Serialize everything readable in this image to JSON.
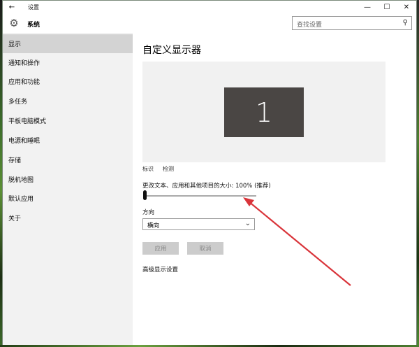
{
  "window": {
    "title": "设置",
    "back_icon": "back-arrow-icon",
    "controls": {
      "minimize": "—",
      "maximize": "☐",
      "close": "✕"
    }
  },
  "header": {
    "app_title": "系统",
    "search_placeholder": "查找设置"
  },
  "sidebar": {
    "items": [
      {
        "label": "显示",
        "active": true
      },
      {
        "label": "通知和操作"
      },
      {
        "label": "应用和功能"
      },
      {
        "label": "多任务"
      },
      {
        "label": "平板电脑模式"
      },
      {
        "label": "电源和睡眠"
      },
      {
        "label": "存储"
      },
      {
        "label": "脱机地图"
      },
      {
        "label": "默认应用"
      },
      {
        "label": "关于"
      }
    ]
  },
  "main": {
    "title": "自定义显示器",
    "monitor_number": "1",
    "identify_link": "标识",
    "detect_link": "检测",
    "scale_label": "更改文本、应用和其他项目的大小: 100% (推荐)",
    "scale_value": 100,
    "orientation_label": "方向",
    "orientation_value": "横向",
    "apply_button": "应用",
    "cancel_button": "取消",
    "advanced_link": "高级显示设置"
  },
  "colors": {
    "sidebar_bg": "#f2f2f2",
    "active_item": "#d3d3d3",
    "monitor": "#4a4644",
    "annotation_arrow": "#d9343a"
  }
}
